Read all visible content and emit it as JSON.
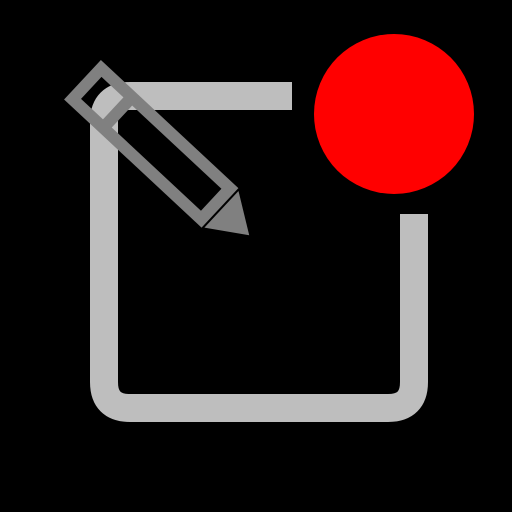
{
  "icon": {
    "name": "edit-with-notification-icon",
    "background_color": "#000000",
    "frame_color": "#BEBEBE",
    "pencil_color": "#808080",
    "badge_color": "#FF0000",
    "badge_visible": true
  }
}
